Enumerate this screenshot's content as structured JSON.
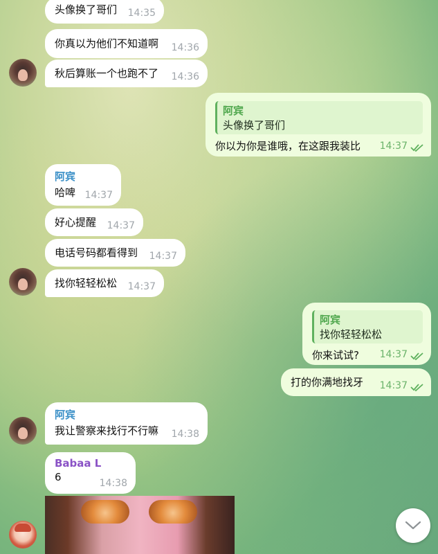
{
  "messages": [
    {
      "text": "头像换了哥们",
      "time": "14:35"
    },
    {
      "text": "你真以为他们不知道啊",
      "time": "14:36"
    },
    {
      "text": "秋后算账一个也跑不了",
      "time": "14:36"
    },
    {
      "quote_name": "阿宾",
      "quote_text": "头像换了哥们",
      "text": "你以为你是谁哦，在这跟我装比",
      "time": "14:37"
    },
    {
      "sender": "阿宾",
      "text": "哈啤",
      "time": "14:37"
    },
    {
      "text": "好心提醒",
      "time": "14:37"
    },
    {
      "text": "电话号码都看得到",
      "time": "14:37"
    },
    {
      "text": "找你轻轻松松",
      "time": "14:37"
    },
    {
      "quote_name": "阿宾",
      "quote_text": "找你轻轻松松",
      "text": "你来试试?",
      "time": "14:37"
    },
    {
      "text": "打的你满地找牙",
      "time": "14:37"
    },
    {
      "sender": "阿宾",
      "text": "我让警察来找行不行嘛",
      "time": "14:38"
    },
    {
      "sender": "Babaa L",
      "text": "6",
      "time": "14:38"
    }
  ],
  "icons": {
    "read_receipt": "double-check-icon",
    "scroll_down": "chevron-down-icon"
  },
  "colors": {
    "incoming_bubble": "#ffffff",
    "outgoing_bubble": "#effdde",
    "sender_blue": "#3a8fc7",
    "sender_purple": "#8a52c6",
    "read_check": "#5fb15e"
  }
}
